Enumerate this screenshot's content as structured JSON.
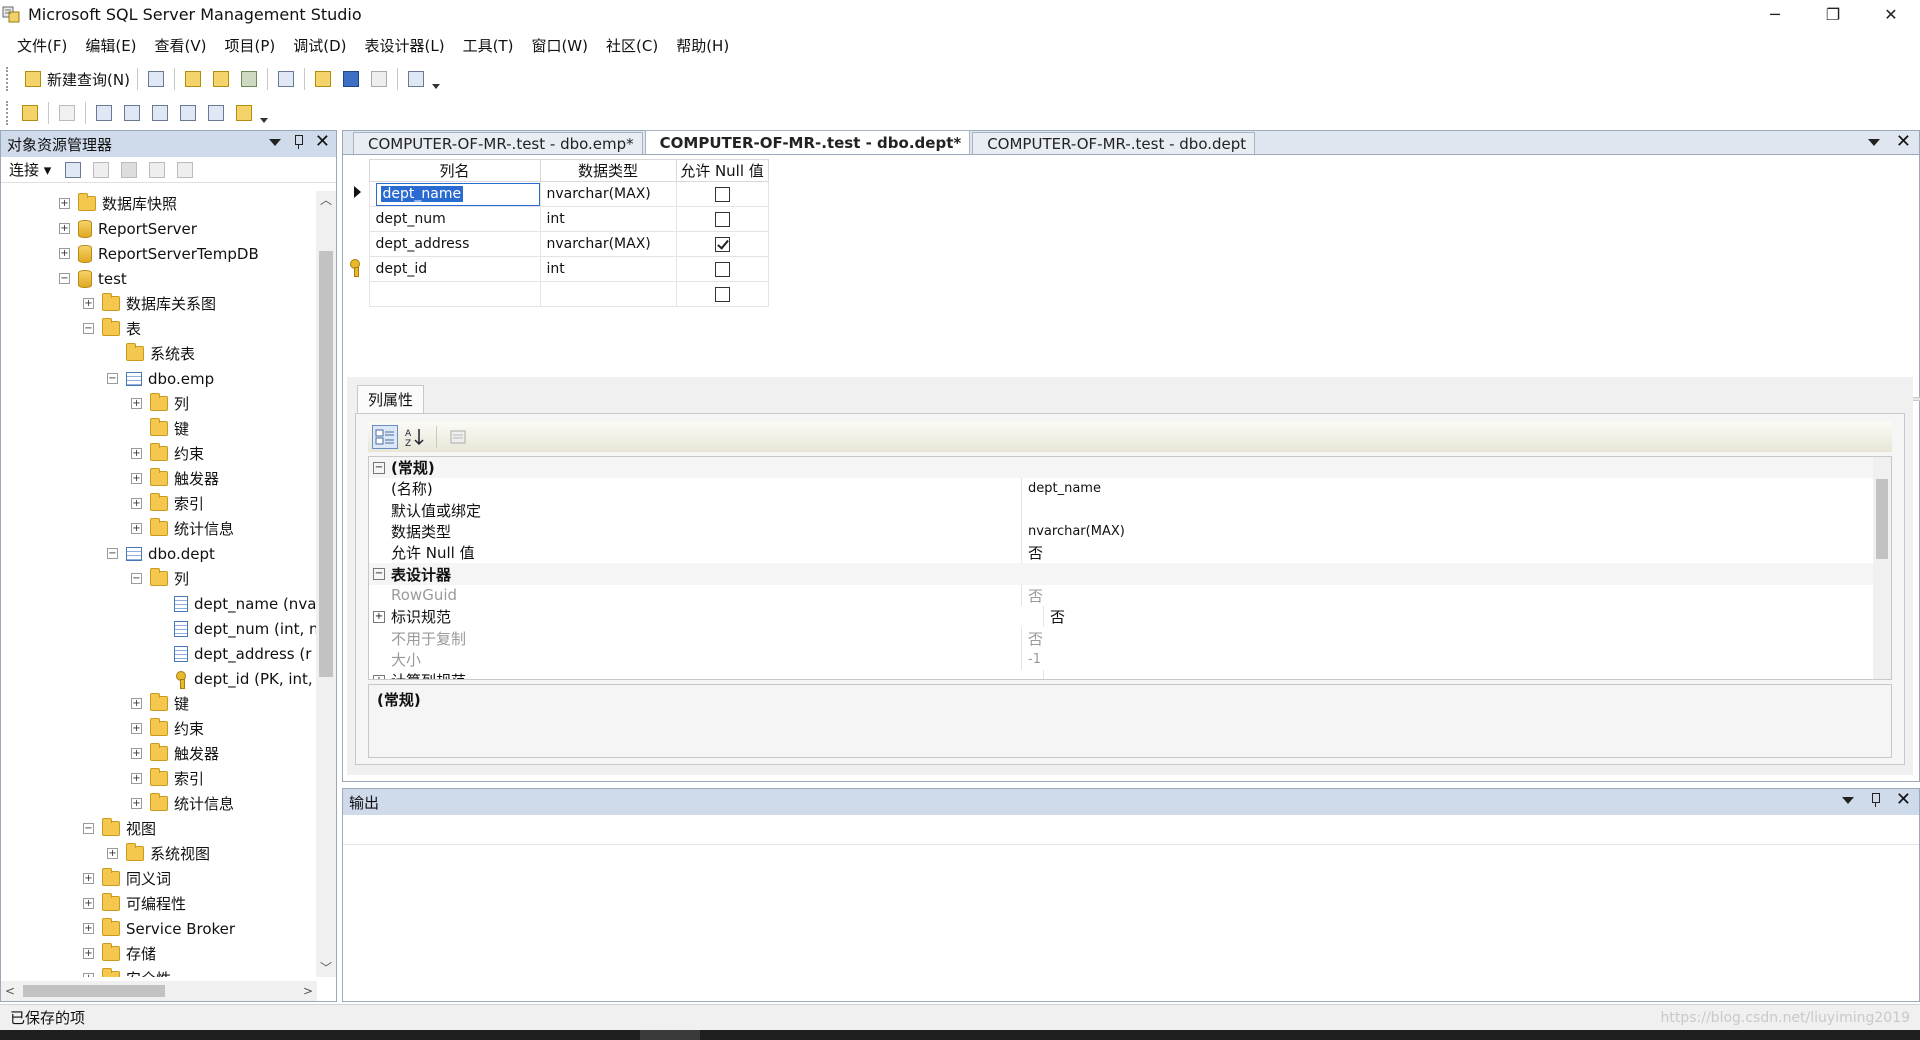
{
  "window": {
    "title": "Microsoft SQL Server Management Studio",
    "minimize": "─",
    "restore": "❐",
    "close": "✕"
  },
  "menu": [
    "文件(F)",
    "编辑(E)",
    "查看(V)",
    "项目(P)",
    "调试(D)",
    "表设计器(L)",
    "工具(T)",
    "窗口(W)",
    "社区(C)",
    "帮助(H)"
  ],
  "toolbar": {
    "new_query": "新建查询(N)"
  },
  "object_explorer": {
    "title": "对象资源管理器",
    "connect": "连接 ▾",
    "tree": [
      {
        "label": "数据库快照",
        "level": 2,
        "exp": "+",
        "icon": "folder"
      },
      {
        "label": "ReportServer",
        "level": 2,
        "exp": "+",
        "icon": "db"
      },
      {
        "label": "ReportServerTempDB",
        "level": 2,
        "exp": "+",
        "icon": "db"
      },
      {
        "label": "test",
        "level": 2,
        "exp": "−",
        "icon": "db"
      },
      {
        "label": "数据库关系图",
        "level": 3,
        "exp": "+",
        "icon": "folder"
      },
      {
        "label": "表",
        "level": 3,
        "exp": "−",
        "icon": "folder"
      },
      {
        "label": "系统表",
        "level": 4,
        "exp": "",
        "icon": "folder"
      },
      {
        "label": "dbo.emp",
        "level": 4,
        "exp": "−",
        "icon": "table"
      },
      {
        "label": "列",
        "level": 5,
        "exp": "+",
        "icon": "folder"
      },
      {
        "label": "键",
        "level": 5,
        "exp": "",
        "icon": "folder"
      },
      {
        "label": "约束",
        "level": 5,
        "exp": "+",
        "icon": "folder"
      },
      {
        "label": "触发器",
        "level": 5,
        "exp": "+",
        "icon": "folder"
      },
      {
        "label": "索引",
        "level": 5,
        "exp": "+",
        "icon": "folder"
      },
      {
        "label": "统计信息",
        "level": 5,
        "exp": "+",
        "icon": "folder"
      },
      {
        "label": "dbo.dept",
        "level": 4,
        "exp": "−",
        "icon": "table"
      },
      {
        "label": "列",
        "level": 5,
        "exp": "−",
        "icon": "folder"
      },
      {
        "label": "dept_name (nva",
        "level": 6,
        "exp": "",
        "icon": "column"
      },
      {
        "label": "dept_num (int, n",
        "level": 6,
        "exp": "",
        "icon": "column"
      },
      {
        "label": "dept_address (r",
        "level": 6,
        "exp": "",
        "icon": "column"
      },
      {
        "label": "dept_id (PK, int,",
        "level": 6,
        "exp": "",
        "icon": "key"
      },
      {
        "label": "键",
        "level": 5,
        "exp": "+",
        "icon": "folder"
      },
      {
        "label": "约束",
        "level": 5,
        "exp": "+",
        "icon": "folder"
      },
      {
        "label": "触发器",
        "level": 5,
        "exp": "+",
        "icon": "folder"
      },
      {
        "label": "索引",
        "level": 5,
        "exp": "+",
        "icon": "folder"
      },
      {
        "label": "统计信息",
        "level": 5,
        "exp": "+",
        "icon": "folder"
      },
      {
        "label": "视图",
        "level": 3,
        "exp": "−",
        "icon": "folder"
      },
      {
        "label": "系统视图",
        "level": 4,
        "exp": "+",
        "icon": "folder"
      },
      {
        "label": "同义词",
        "level": 3,
        "exp": "+",
        "icon": "folder"
      },
      {
        "label": "可编程性",
        "level": 3,
        "exp": "+",
        "icon": "folder"
      },
      {
        "label": "Service Broker",
        "level": 3,
        "exp": "+",
        "icon": "folder"
      },
      {
        "label": "存储",
        "level": 3,
        "exp": "+",
        "icon": "folder"
      },
      {
        "label": "安全性",
        "level": 3,
        "exp": "+",
        "icon": "folder"
      }
    ]
  },
  "tabs": [
    {
      "label": "COMPUTER-OF-MR-.test - dbo.emp*",
      "active": false
    },
    {
      "label": "COMPUTER-OF-MR-.test - dbo.dept*",
      "active": true
    },
    {
      "label": "COMPUTER-OF-MR-.test - dbo.dept",
      "active": false
    }
  ],
  "designer": {
    "headers": {
      "name": "列名",
      "type": "数据类型",
      "null": "允许 Null 值"
    },
    "rows": [
      {
        "name": "dept_name",
        "type": "nvarchar(MAX)",
        "allow_null": false,
        "selected": true,
        "pk": false
      },
      {
        "name": "dept_num",
        "type": "int",
        "allow_null": false,
        "selected": false,
        "pk": false
      },
      {
        "name": "dept_address",
        "type": "nvarchar(MAX)",
        "allow_null": true,
        "selected": false,
        "pk": false
      },
      {
        "name": "dept_id",
        "type": "int",
        "allow_null": false,
        "selected": false,
        "pk": true
      },
      {
        "name": "",
        "type": "",
        "allow_null": false,
        "selected": false,
        "pk": false
      }
    ]
  },
  "column_properties": {
    "tab": "列属性",
    "rows": [
      {
        "kind": "cat",
        "exp": "−",
        "name": "(常规)",
        "value": ""
      },
      {
        "kind": "prop",
        "name": "(名称)",
        "value": "dept_name"
      },
      {
        "kind": "prop",
        "name": "默认值或绑定",
        "value": ""
      },
      {
        "kind": "prop",
        "name": "数据类型",
        "value": "nvarchar(MAX)"
      },
      {
        "kind": "prop",
        "name": "允许 Null 值",
        "value": "否",
        "big": true
      },
      {
        "kind": "cat",
        "exp": "−",
        "name": "表设计器",
        "value": ""
      },
      {
        "kind": "dim",
        "name": "RowGuid",
        "value": "否",
        "big": true
      },
      {
        "kind": "sub",
        "exp": "+",
        "name": "标识规范",
        "value": "否",
        "big": true
      },
      {
        "kind": "dim",
        "name": "不用于复制",
        "value": "否",
        "big": true
      },
      {
        "kind": "dim",
        "name": "大小",
        "value": "-1"
      },
      {
        "kind": "sub",
        "exp": "+",
        "name": "计算列规范",
        "value": ""
      }
    ],
    "description": "(常规)"
  },
  "output": {
    "title": "输出"
  },
  "status": {
    "text": "已保存的项",
    "watermark": "https://blog.csdn.net/liuyiming2019"
  }
}
